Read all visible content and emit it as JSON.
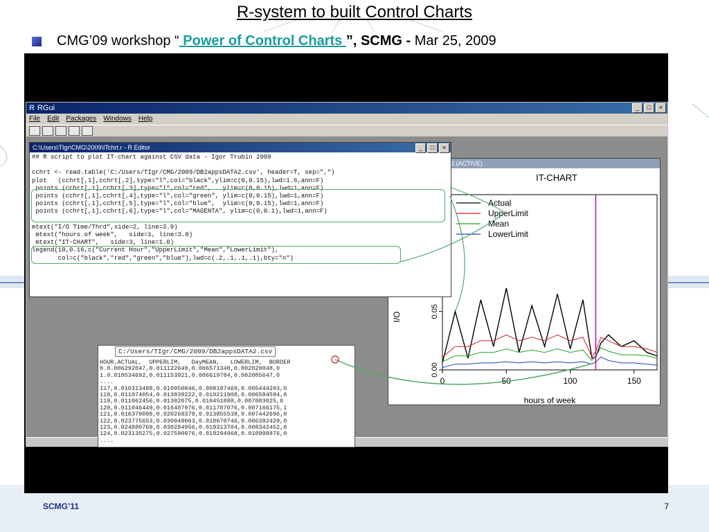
{
  "slide": {
    "title": "R-system to built Control Charts",
    "subtitle_pre": "CMG’09 workshop “",
    "subtitle_link": " Power of Control Charts ",
    "subtitle_post_bold": "”, SCMG - ",
    "subtitle_date": "Mar 25, 2009",
    "footer_left": "SCMG’11",
    "page_number": "7"
  },
  "rgui": {
    "title": "RGui",
    "menu": [
      "File",
      "Edit",
      "Packages",
      "Windows",
      "Help"
    ]
  },
  "editor": {
    "title": "C:\\Users\\TIgr\\CMG\\2009\\ITchrt.r - R Editor",
    "lines": [
      "## R script to plot IT-chart against CSV data - Igor Trubin 2009",
      "",
      "cchrt <- read.table('C:/Users/TIgr/CMG/2009/DB2appsDATA2.csv', header=T, sep=\",\")",
      "plot   (cchrt[,1],cchrt[,2],type=\"l\",col=\"black\",ylim=c(0,0.15),lwd=1.6,ann=F)",
      " points (cchrt[,1],cchrt[,3],type=\"l\",col=\"red\",   ylim=c(0,0.15),lwd=1,ann=F)",
      " points (cchrt[,1],cchrt[,4],type=\"l\",col=\"green\", ylim=c(0,0.15),lwd=1,ann=F)",
      " points (cchrt[,1],cchrt[,5],type=\"l\",col=\"blue\",  ylim=c(0,0.15),lwd=1,ann=F)",
      " points (cchrt[,1],cchrt[,6],type=\"l\",col=\"MAGENTA\", ylim=c(0,0.1),lwd=1,ann=F)",
      "",
      "mtext(\"I/O Time/Thrd\",side=2, line=3.0)",
      " mtext(\"hours of week\",   side=1, line=3.0)",
      " mtext(\"IT-CHART\",   side=3, line=1.0)",
      "legend(10,0.16,c(\"Current Hour\",\"UpperLimit\",\"Mean\",\"LowerLimit\"),",
      "       col=c(\"black\",\"red\",\"green\",\"blue\"),lwd=c(.2,.1,.1,.1),bty=\"n\")"
    ]
  },
  "csv": {
    "path": "C:/Users/TIgr/CMG/2009/DB2appsDATA2.csv",
    "lines": [
      "HOUR,ACTUAL,  UPPERLIM,   DayMEAN,   LOWERLIM,  BORDER",
      "0.0.006292047,0.011122649,0.006571348,0.002020048,0",
      "1.0.010534692,0.011153921,0.006619784,0.002085647,0",
      "....",
      "117,0.010313488,0.010950846,0.008197469,0.005444293,0",
      "118,0.011074054,0.013839222,0.010211908,0.006584594,0",
      "119,0.011062456,0.01382075,0.010451888,0.007083025,0",
      "120,0.011046449,0.016407976,0.011787076,0.007166175,1",
      "121,0.016379098,0.020268379,0.013855538,0.007442696,0",
      "122,0.023775653,0.030949063,0.018670746,0.006392429,0",
      "123,0.024880769,0.030284956,0.019313704,0.008342452,0",
      "124,0.023135275,0.027590976,0.019294968,0.010998876,0",
      "...."
    ]
  },
  "graph_window": {
    "title": "Device 2 (ACTIVE)"
  },
  "chart_data": {
    "type": "line",
    "title": "IT-CHART",
    "xlabel": "hours of week",
    "ylabel": "I/O",
    "xlim": [
      0,
      168
    ],
    "ylim": [
      0,
      0.15
    ],
    "x_ticks": [
      "0",
      "50",
      "100",
      "150"
    ],
    "y_ticks": [
      "0.00",
      "0.05"
    ],
    "legend": [
      "Actual",
      "UpperLimit",
      "Mean",
      "LowerLimit"
    ],
    "legend_position": "top-left",
    "colors": {
      "Actual": "#000000",
      "UpperLimit": "#d02020",
      "Mean": "#20a020",
      "LowerLimit": "#2040c0",
      "Border": "#c000c0"
    },
    "x": [
      0,
      10,
      20,
      30,
      40,
      50,
      60,
      70,
      80,
      90,
      100,
      110,
      117,
      120,
      124,
      130,
      140,
      150,
      160,
      168
    ],
    "series": [
      {
        "name": "Actual",
        "values": [
          0.006,
          0.05,
          0.01,
          0.06,
          0.02,
          0.07,
          0.015,
          0.055,
          0.02,
          0.065,
          0.018,
          0.06,
          0.01,
          0.011,
          0.023,
          0.03,
          0.02,
          0.025,
          0.015,
          0.012
        ]
      },
      {
        "name": "UpperLimit",
        "values": [
          0.011,
          0.02,
          0.02,
          0.025,
          0.025,
          0.03,
          0.025,
          0.028,
          0.025,
          0.03,
          0.025,
          0.028,
          0.011,
          0.016,
          0.028,
          0.025,
          0.02,
          0.02,
          0.018,
          0.015
        ]
      },
      {
        "name": "Mean",
        "values": [
          0.007,
          0.012,
          0.012,
          0.015,
          0.015,
          0.018,
          0.015,
          0.017,
          0.015,
          0.018,
          0.015,
          0.017,
          0.008,
          0.012,
          0.019,
          0.016,
          0.013,
          0.013,
          0.012,
          0.01
        ]
      },
      {
        "name": "LowerLimit",
        "values": [
          0.002,
          0.005,
          0.005,
          0.006,
          0.006,
          0.007,
          0.006,
          0.007,
          0.006,
          0.007,
          0.006,
          0.007,
          0.005,
          0.007,
          0.011,
          0.008,
          0.006,
          0.006,
          0.005,
          0.004
        ]
      }
    ],
    "border_x": 120
  }
}
